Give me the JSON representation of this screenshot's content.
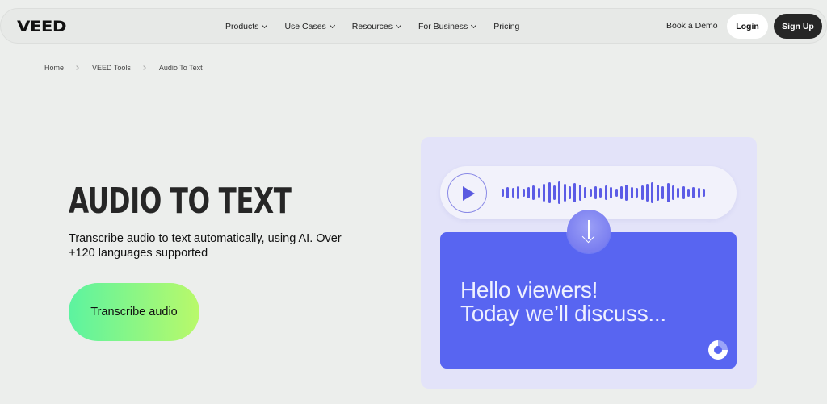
{
  "brand": {
    "logo_text": "VEED"
  },
  "nav": {
    "links": [
      {
        "label": "Products",
        "has_dropdown": true
      },
      {
        "label": "Use Cases",
        "has_dropdown": true
      },
      {
        "label": "Resources",
        "has_dropdown": true
      },
      {
        "label": "For Business",
        "has_dropdown": true
      },
      {
        "label": "Pricing",
        "has_dropdown": false
      }
    ],
    "demo_label": "Book a Demo",
    "login_label": "Login",
    "signup_label": "Sign Up"
  },
  "breadcrumb": [
    "Home",
    "VEED Tools",
    "Audio To Text"
  ],
  "hero": {
    "title": "AUDIO TO TEXT",
    "subtitle": "Transcribe audio to text automatically, using AI. Over +120 languages supported",
    "cta_label": "Transcribe audio"
  },
  "illustration": {
    "transcript_lines": [
      "Hello viewers!",
      "Today we’ll discuss..."
    ],
    "colors": {
      "card": "#5865f1",
      "panel": "#e3e3f9",
      "wave": "#5c5ce6"
    },
    "icons": [
      "play-icon",
      "arrow-down-icon",
      "progress-donut-icon"
    ]
  },
  "colors": {
    "page_bg": "#eceeec",
    "cta_gradient_start": "#5cf3a0",
    "cta_gradient_end": "#b9f96a",
    "signup_bg": "#262626"
  }
}
